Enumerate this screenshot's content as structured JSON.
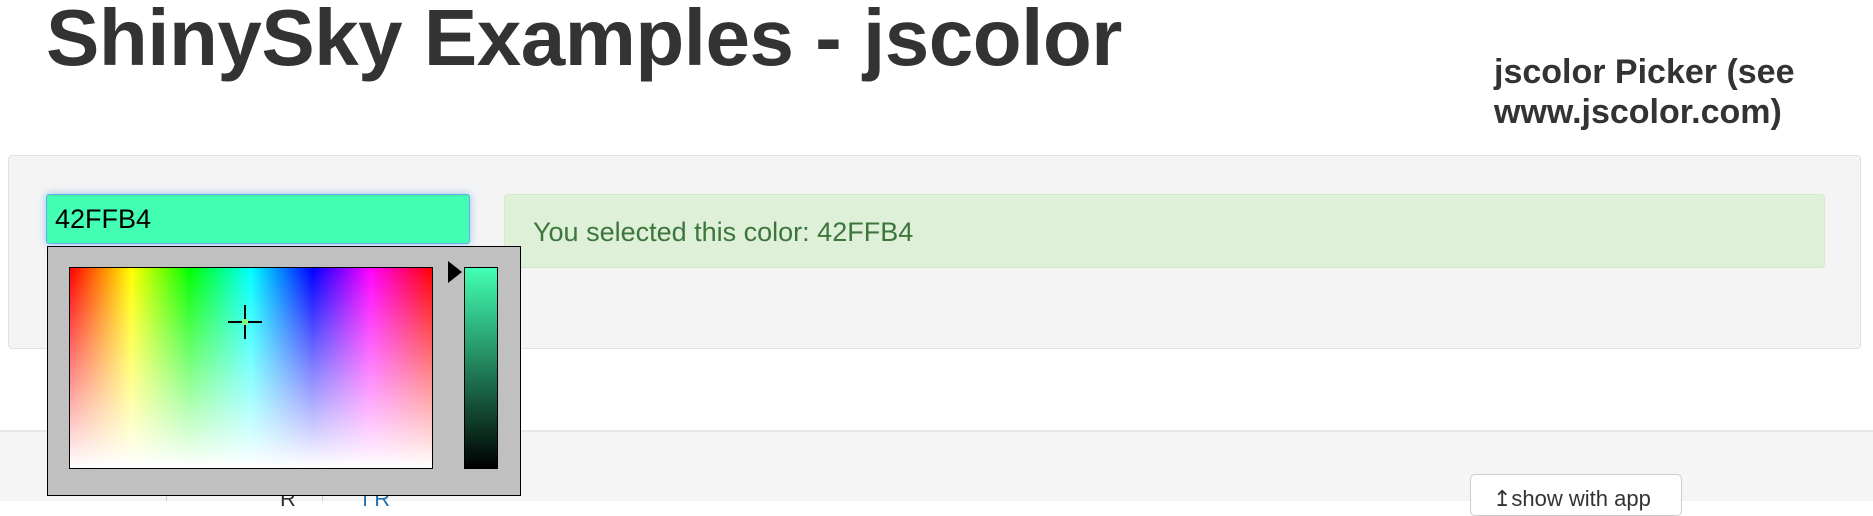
{
  "header": {
    "title": "ShinySky Examples - jscolor",
    "picker_heading": "jscolor Picker (see www.jscolor.com)"
  },
  "color_input": {
    "value": "42FFB4",
    "background": "#42FFB4"
  },
  "alert": {
    "text": "You selected this color: 42FFB4"
  },
  "lower": {
    "show_with_app_label": "↥show with app",
    "tab_fragments": [
      "R",
      "ı R"
    ]
  },
  "picker": {
    "selected_hex": "#42FFB4",
    "icons": [
      "crosshair-icon",
      "slider-arrow-icon"
    ]
  },
  "colors": {
    "alert_bg": "#dff0d8",
    "alert_text": "#3c763d",
    "focus_border": "#66afe9",
    "well_bg": "#f4f4f4"
  }
}
